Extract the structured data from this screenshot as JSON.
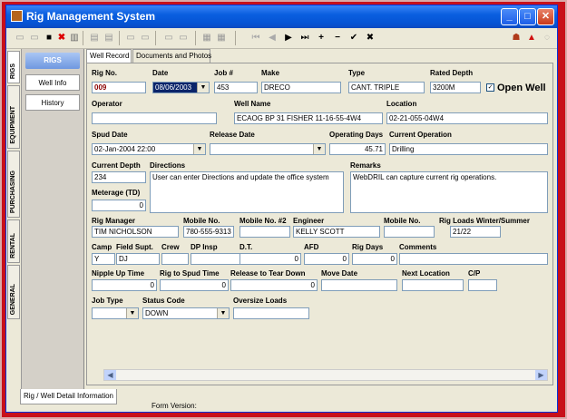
{
  "window": {
    "title": "Rig Management System"
  },
  "side_tabs": [
    "RIGS",
    "EQUIPMENT",
    "PURCHASING",
    "RENTAL",
    "GENERAL"
  ],
  "left_nav": {
    "header": "RIGS",
    "items": [
      "Well Info",
      "History"
    ]
  },
  "tabs": [
    "Well Record",
    "Documents and Photos"
  ],
  "form": {
    "rig_no": {
      "label": "Rig No.",
      "value": "009"
    },
    "date": {
      "label": "Date",
      "value": "08/06/2003"
    },
    "job_no": {
      "label": "Job #",
      "value": "453"
    },
    "make": {
      "label": "Make",
      "value": "DRECO"
    },
    "type": {
      "label": "Type",
      "value": "CANT. TRIPLE"
    },
    "rated_depth": {
      "label": "Rated Depth",
      "value": "3200M"
    },
    "open_well": {
      "label": "Open Well",
      "checked": true
    },
    "operator": {
      "label": "Operator",
      "value": ""
    },
    "well_name": {
      "label": "Well Name",
      "value": "ECAOG BP 31 FISHER 11-16-55-4W4"
    },
    "location": {
      "label": "Location",
      "value": "02-21-055-04W4"
    },
    "spud_date": {
      "label": "Spud Date",
      "value": "02-Jan-2004 22:00"
    },
    "release_date": {
      "label": "Release Date",
      "value": ""
    },
    "operating_days": {
      "label": "Operating Days",
      "value": "45.71"
    },
    "current_operation": {
      "label": "Current Operation",
      "value": "Drilling"
    },
    "current_depth": {
      "label": "Current Depth",
      "value": "234"
    },
    "directions": {
      "label": "Directions",
      "value": "User can enter Directions and update the office system"
    },
    "remarks": {
      "label": "Remarks",
      "value": "WebDRIL can capture current rig operations."
    },
    "meterage": {
      "label": "Meterage (TD)",
      "value": "0"
    },
    "rig_manager": {
      "label": "Rig Manager",
      "value": "TIM NICHOLSON"
    },
    "mobile_no": {
      "label": "Mobile No.",
      "value": "780-555-9313"
    },
    "mobile_no2": {
      "label": "Mobile No. #2",
      "value": ""
    },
    "engineer": {
      "label": "Engineer",
      "value": "KELLY SCOTT"
    },
    "engineer_mobile": {
      "label": "Mobile No.",
      "value": ""
    },
    "rig_loads": {
      "label": "Rig Loads Winter/Summer",
      "value": "21/22"
    },
    "camp": {
      "label": "Camp",
      "value": "Y"
    },
    "field_supt": {
      "label": "Field Supt.",
      "value": "DJ"
    },
    "crew": {
      "label": "Crew",
      "value": ""
    },
    "dp_insp": {
      "label": "DP Insp",
      "value": "291"
    },
    "dt": {
      "label": "D.T.",
      "value": "0"
    },
    "afd": {
      "label": "AFD",
      "value": "0"
    },
    "rig_days": {
      "label": "Rig Days",
      "value": "0"
    },
    "comments": {
      "label": "Comments",
      "value": ""
    },
    "nipple_up_time": {
      "label": "Nipple Up Time",
      "value": "0"
    },
    "rig_to_spud_time": {
      "label": "Rig to Spud Time",
      "value": "0"
    },
    "release_to_tear_down": {
      "label": "Release to Tear Down",
      "value": "0"
    },
    "move_date": {
      "label": "Move Date",
      "value": ""
    },
    "next_location": {
      "label": "Next Location",
      "value": ""
    },
    "cp": {
      "label": "C/P",
      "value": ""
    },
    "job_type": {
      "label": "Job Type",
      "value": ""
    },
    "status_code": {
      "label": "Status Code",
      "value": "DOWN"
    },
    "oversize_loads": {
      "label": "Oversize Loads",
      "value": ""
    }
  },
  "status": {
    "tab": "Rig / Well Detail Information",
    "form_version": "Form Version:"
  }
}
